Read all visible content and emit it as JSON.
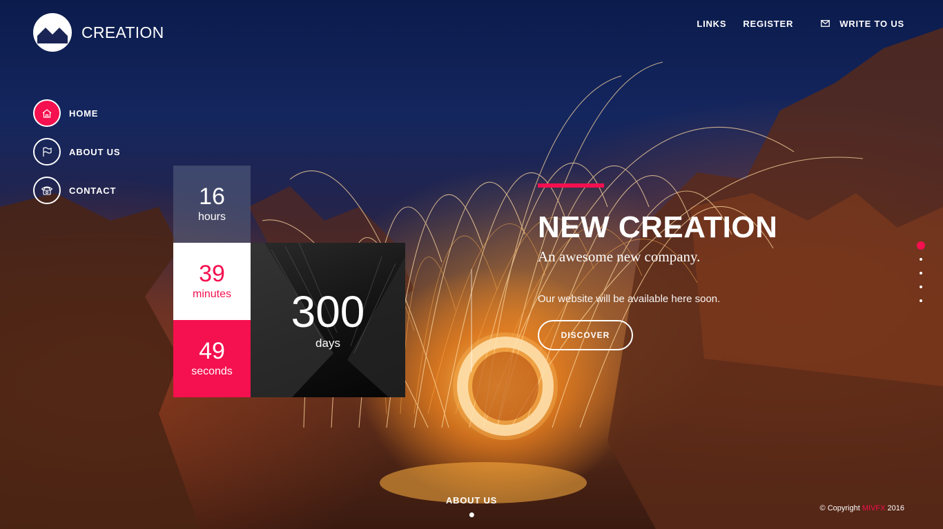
{
  "brand": {
    "name": "CREATION",
    "logo_icon": "mountain-logo-icon"
  },
  "topnav": {
    "items": [
      {
        "label": "LINKS"
      },
      {
        "label": "REGISTER"
      },
      {
        "label": "WRITE TO US",
        "icon": "mail-icon"
      }
    ]
  },
  "sidenav": {
    "items": [
      {
        "label": "HOME",
        "icon": "home-icon",
        "active": true
      },
      {
        "label": "ABOUT US",
        "icon": "flag-icon",
        "active": false
      },
      {
        "label": "CONTACT",
        "icon": "phone-icon",
        "active": false
      }
    ]
  },
  "countdown": {
    "hours": {
      "value": "16",
      "unit": "hours"
    },
    "minutes": {
      "value": "39",
      "unit": "minutes"
    },
    "seconds": {
      "value": "49",
      "unit": "seconds"
    },
    "days": {
      "value": "300",
      "unit": "days"
    }
  },
  "hero": {
    "title": "NEW CREATION",
    "subtitle": "An awesome new company.",
    "description": "Our website will be available here soon.",
    "button_label": "DISCOVER"
  },
  "pagination": {
    "count": 5,
    "active_index": 0
  },
  "bottom": {
    "link_label": "ABOUT US"
  },
  "footer": {
    "copyright_prefix": "© Copyright ",
    "brand": "MIVFX",
    "year": " 2016"
  },
  "colors": {
    "accent": "#f5104f",
    "text": "#ffffff"
  }
}
